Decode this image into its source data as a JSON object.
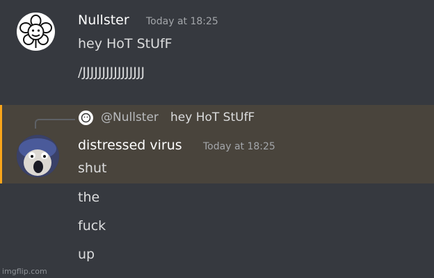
{
  "message1": {
    "username": "Nullster",
    "timestamp": "Today at 18:25",
    "lines": [
      "hey HoT StUfF",
      "/JJJJJJJJJJJJJJJJ"
    ],
    "avatar_icon": "flower-face-icon"
  },
  "message2": {
    "reply": {
      "mention": "@Nullster",
      "text": "hey HoT StUfF",
      "icon": "flower-face-icon"
    },
    "username": "distressed virus",
    "timestamp": "Today at 18:25",
    "lines": [
      "shut",
      "the",
      "fuck",
      "up"
    ],
    "avatar_icon": "screaming-creature-icon"
  },
  "watermark": "imgflip.com",
  "colors": {
    "background": "#36393f",
    "highlight": "#49443c",
    "highlight_bar": "#faa61a"
  }
}
